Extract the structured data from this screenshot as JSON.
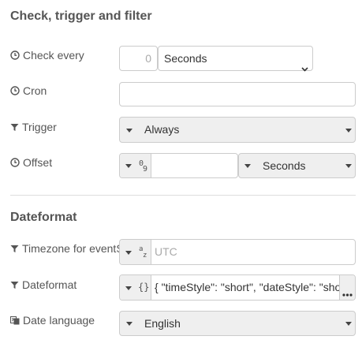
{
  "sections": {
    "trigger_title": "Check, trigger and filter",
    "dateformat_title": "Dateformat"
  },
  "check_every": {
    "label": "Check every",
    "value": "0",
    "unit": "Seconds"
  },
  "cron": {
    "label": "Cron",
    "value": ""
  },
  "trigger": {
    "label": "Trigger",
    "value": "Always"
  },
  "offset": {
    "label": "Offset",
    "type_glyph": "0₉",
    "value": "",
    "unit": "Seconds"
  },
  "timezone": {
    "label": "Timezone for eventS",
    "type_glyph": "az",
    "placeholder": "UTC"
  },
  "dateformat": {
    "label": "Dateformat",
    "type_glyph": "{}",
    "value": "{ \"timeStyle\": \"short\", \"dateStyle\": \"shor"
  },
  "date_language": {
    "label": "Date language",
    "value": "English"
  },
  "icons": {
    "clock": "clock-icon",
    "filter": "filter-icon",
    "language": "language-icon",
    "caret": "caret-down-icon",
    "ellipsis": "ellipsis-icon"
  }
}
